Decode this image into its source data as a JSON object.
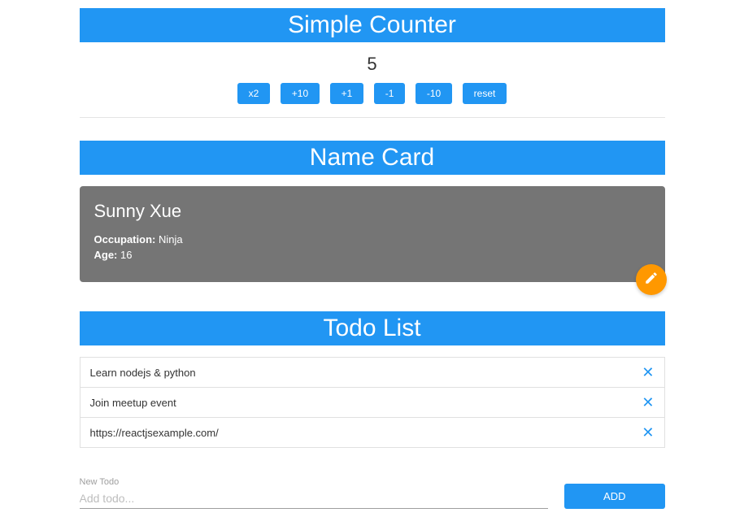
{
  "counter": {
    "title": "Simple Counter",
    "value": "5",
    "buttons": [
      "x2",
      "+10",
      "+1",
      "-1",
      "-10",
      "reset"
    ]
  },
  "nameCard": {
    "title": "Name Card",
    "name": "Sunny Xue",
    "occupationLabel": "Occupation:",
    "occupationValue": "Ninja",
    "ageLabel": "Age:",
    "ageValue": "16"
  },
  "todo": {
    "title": "Todo List",
    "items": [
      "Learn nodejs & python",
      "Join meetup event",
      "https://reactjsexample.com/"
    ],
    "newLabel": "New Todo",
    "placeholder": "Add todo...",
    "addLabel": "ADD"
  }
}
